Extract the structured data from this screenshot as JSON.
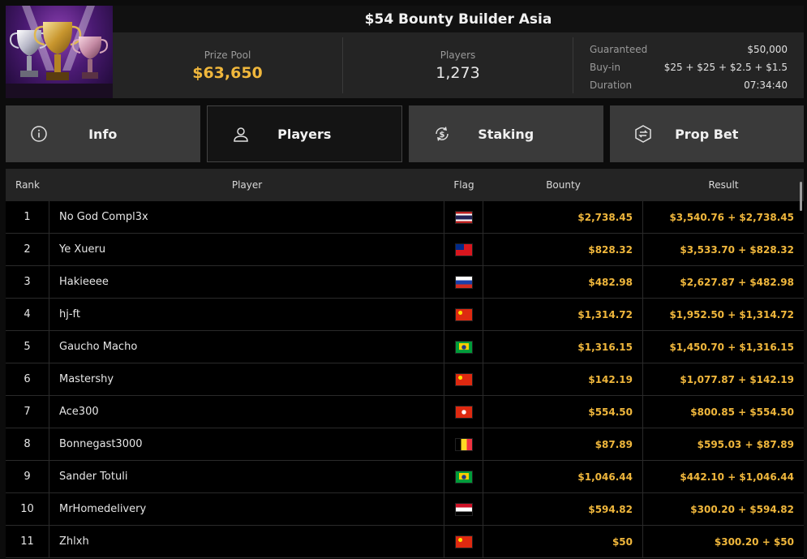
{
  "tournament": {
    "title": "$54 Bounty Builder Asia",
    "prize_pool_label": "Prize Pool",
    "prize_pool": "$63,650",
    "players_label": "Players",
    "players": "1,273",
    "details": [
      {
        "key": "Guaranteed",
        "value": "$50,000"
      },
      {
        "key": "Buy-in",
        "value": "$25 + $25 + $2.5 + $1.5"
      },
      {
        "key": "Duration",
        "value": "07:34:40"
      }
    ]
  },
  "tabs": [
    {
      "label": "Info",
      "icon": "info-icon"
    },
    {
      "label": "Players",
      "icon": "user-icon",
      "active": true
    },
    {
      "label": "Staking",
      "icon": "dollar-refresh-icon"
    },
    {
      "label": "Prop Bet",
      "icon": "prop-bet-icon"
    }
  ],
  "table": {
    "headers": {
      "rank": "Rank",
      "player": "Player",
      "flag": "Flag",
      "bounty": "Bounty",
      "result": "Result"
    },
    "rows": [
      {
        "rank": "1",
        "player": "No God Compl3x",
        "flag": "thailand",
        "bounty": "$2,738.45",
        "result": "$3,540.76 + $2,738.45"
      },
      {
        "rank": "2",
        "player": "Ye Xueru",
        "flag": "taiwan",
        "bounty": "$828.32",
        "result": "$3,533.70 + $828.32"
      },
      {
        "rank": "3",
        "player": "Hakieeee",
        "flag": "russia",
        "bounty": "$482.98",
        "result": "$2,627.87 + $482.98"
      },
      {
        "rank": "4",
        "player": "hj-ft",
        "flag": "china",
        "bounty": "$1,314.72",
        "result": "$1,952.50 + $1,314.72"
      },
      {
        "rank": "5",
        "player": "Gaucho Macho",
        "flag": "brazil",
        "bounty": "$1,316.15",
        "result": "$1,450.70 + $1,316.15"
      },
      {
        "rank": "6",
        "player": "Mastershy",
        "flag": "china",
        "bounty": "$142.19",
        "result": "$1,077.87 + $142.19"
      },
      {
        "rank": "7",
        "player": "Ace300",
        "flag": "hongkong",
        "bounty": "$554.50",
        "result": "$800.85 + $554.50"
      },
      {
        "rank": "8",
        "player": "Bonnegast3000",
        "flag": "belgium",
        "bounty": "$87.89",
        "result": "$595.03 + $87.89"
      },
      {
        "rank": "9",
        "player": "Sander Totuli",
        "flag": "brazil",
        "bounty": "$1,046.44",
        "result": "$442.10 + $1,046.44"
      },
      {
        "rank": "10",
        "player": "MrHomedelivery",
        "flag": "egypt",
        "bounty": "$594.82",
        "result": "$300.20 + $594.82"
      },
      {
        "rank": "11",
        "player": "Zhlxh",
        "flag": "china",
        "bounty": "$50",
        "result": "$300.20 + $50"
      }
    ]
  },
  "colors": {
    "accent": "#f0b73c",
    "tab_bg": "#3a3a3a",
    "tab_active_bg": "#141414"
  }
}
